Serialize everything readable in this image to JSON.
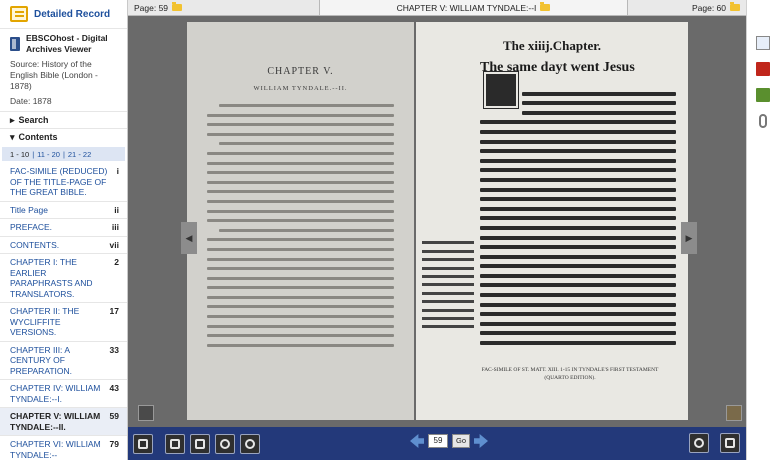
{
  "sidebar": {
    "header_title": "Detailed Record",
    "source_title": "EBSCOhost - Digital Archives Viewer",
    "source_label": "Source:",
    "source_value": "History of the English Bible (London - 1878)",
    "date_label": "Date:",
    "date_value": "1878",
    "search_label": "Search",
    "contents_label": "Contents",
    "pager": {
      "current": "1 - 10",
      "links": [
        "11 - 20",
        "21 - 22"
      ]
    },
    "toc": [
      {
        "label": "FAC-SIMILE (REDUCED) OF THE TITLE-PAGE OF THE GREAT BIBLE.",
        "page": "i"
      },
      {
        "label": "Title Page",
        "page": "ii"
      },
      {
        "label": "PREFACE.",
        "page": "iii"
      },
      {
        "label": "CONTENTS.",
        "page": "vii"
      },
      {
        "label": "CHAPTER I: THE EARLIER PARAPHRASTS AND TRANSLATORS.",
        "page": "2"
      },
      {
        "label": "CHAPTER II: THE WYCLIFFITE VERSIONS.",
        "page": "17"
      },
      {
        "label": "CHAPTER III: A CENTURY OF PREPARATION.",
        "page": "33"
      },
      {
        "label": "CHAPTER IV: WILLIAM TYNDALE:--I.",
        "page": "43"
      },
      {
        "label": "CHAPTER V: WILLIAM TYNDALE:--II.",
        "page": "59"
      },
      {
        "label": "CHAPTER VI: WILLIAM TYNDALE:--",
        "page": "79"
      }
    ]
  },
  "viewer": {
    "left_page_label": "Page: 59",
    "chapter_label": "CHAPTER V: WILLIAM TYNDALE:--I",
    "right_page_label": "Page: 60",
    "left_page": {
      "heading": "CHAPTER V.",
      "subheading": "WILLIAM TYNDALE.--II."
    },
    "right_page": {
      "heading": "The xiiij.Chapter.",
      "subheading": "The same dayt went Jesus",
      "caption": "FAC-SIMILE OF ST. MATT. XIII. 1-15 IN TYNDALE'S FIRST TESTAMENT",
      "caption2": "(QUARTO EDITION)."
    },
    "page_input": "59",
    "go_label": "Go"
  }
}
